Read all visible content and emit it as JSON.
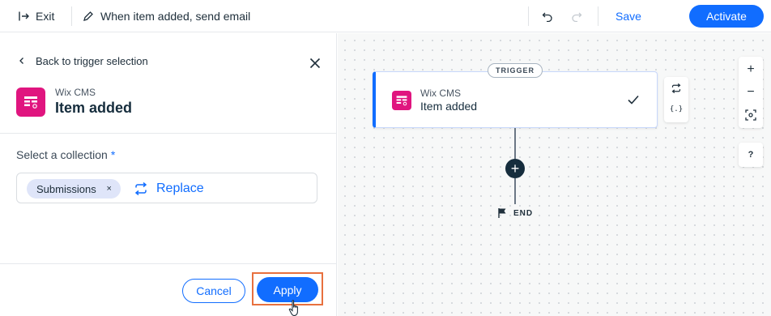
{
  "topbar": {
    "exit_label": "Exit",
    "automation_title": "When item added, send email",
    "save_label": "Save",
    "activate_label": "Activate"
  },
  "panel": {
    "back_label": "Back to trigger selection",
    "app_name": "Wix CMS",
    "trigger_name": "Item added",
    "collection_label": "Select a collection",
    "required_mark": "*",
    "selected_collection": "Submissions",
    "chip_remove": "×",
    "replace_label": "Replace",
    "cancel_label": "Cancel",
    "apply_label": "Apply"
  },
  "canvas": {
    "badge": "TRIGGER",
    "card_app": "Wix CMS",
    "card_title": "Item added",
    "add_symbol": "+",
    "end_label": "END",
    "variables_symbol": "{.}",
    "zoom_in": "+",
    "zoom_out": "−",
    "help": "?"
  },
  "colors": {
    "accent": "#116dff",
    "app_icon": "#e0157f",
    "highlight": "#e8703e"
  }
}
